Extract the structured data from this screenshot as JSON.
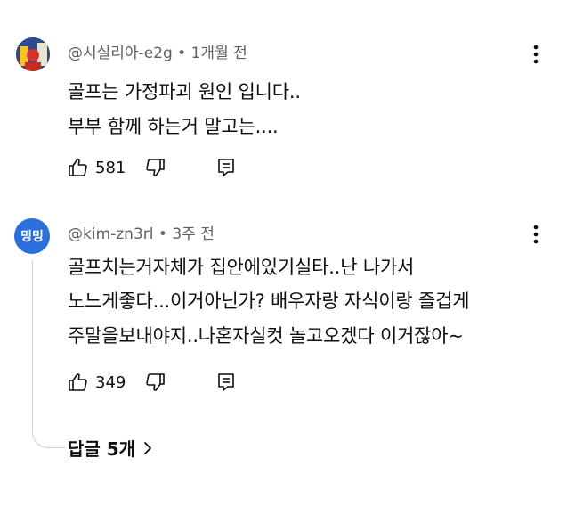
{
  "comments": [
    {
      "author": "@시실리아-e2g",
      "time": "1개월 전",
      "lines": [
        "골프는 가정파괴 원인 입니다..",
        "부부 함께 하는거 말고는...."
      ],
      "likes": "581"
    },
    {
      "author": "@kim-zn3rl",
      "time": "3주 전",
      "avatar_text": "밍밍",
      "lines": [
        "골프치는거자체가 집안에있기실타..난 나가서",
        "노느게좋다...이거아닌가?  배우자랑 자식이랑 즐겁게",
        "주말을보내야지..나혼자실컷 놀고오겠다 이거잖아~"
      ],
      "likes": "349",
      "replies_label": "답글 5개"
    }
  ],
  "separator": "•",
  "colors": {
    "meta": "#606060",
    "text": "#0f0f0f",
    "avatar2_bg": "#2a6fdb"
  },
  "icons": [
    "thumb-up-icon",
    "thumb-down-icon",
    "reply-icon",
    "more-vert-icon",
    "chevron-right-icon"
  ]
}
